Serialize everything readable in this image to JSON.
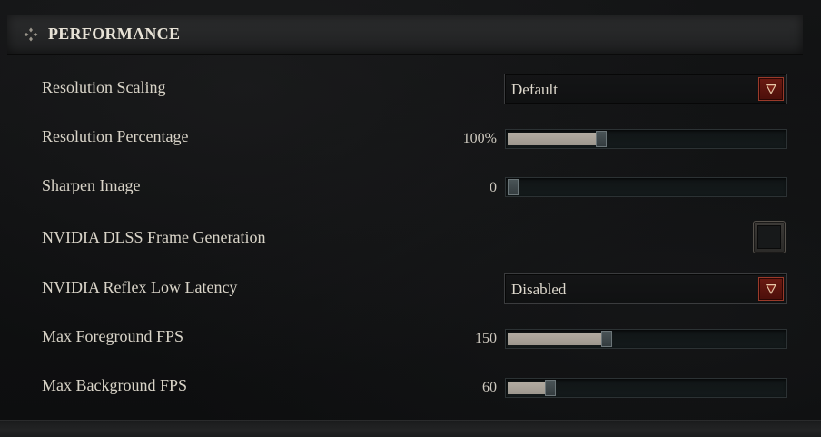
{
  "section": {
    "title": "PERFORMANCE",
    "icon": "diamond-cross-icon"
  },
  "settings": {
    "resolution_scaling": {
      "label": "Resolution Scaling",
      "value": "Default"
    },
    "resolution_percentage": {
      "label": "Resolution Percentage",
      "value_text": "100%",
      "fraction": 0.33
    },
    "sharpen_image": {
      "label": "Sharpen Image",
      "value_text": "0",
      "fraction": 0.0
    },
    "dlss_frame_generation": {
      "label": "NVIDIA DLSS Frame Generation",
      "checked": false
    },
    "reflex_low_latency": {
      "label": "NVIDIA Reflex Low Latency",
      "value": "Disabled"
    },
    "max_foreground_fps": {
      "label": "Max Foreground FPS",
      "value_text": "150",
      "fraction": 0.35
    },
    "max_background_fps": {
      "label": "Max Background FPS",
      "value_text": "60",
      "fraction": 0.14
    }
  },
  "colors": {
    "dropdown_arrow": "#6a1a12",
    "slider_fill": "#b3aca2",
    "text": "#d9d4c8"
  }
}
